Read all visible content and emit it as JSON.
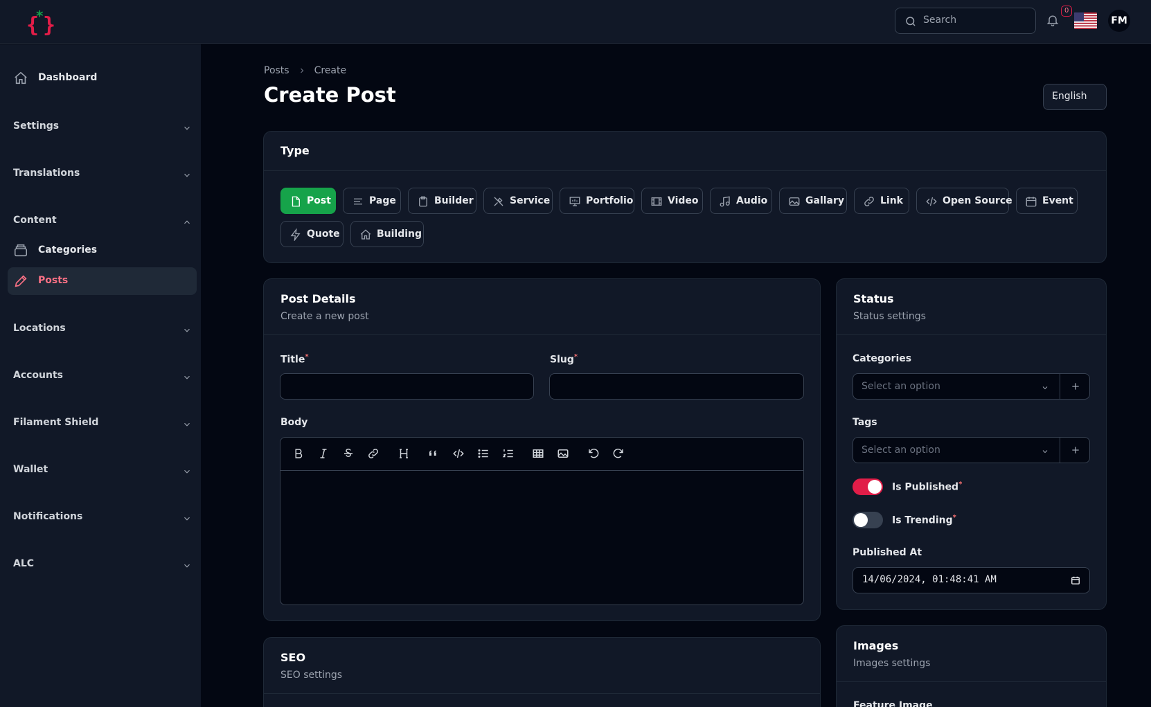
{
  "header": {
    "search_placeholder": "Search",
    "notification_count": "0",
    "user_initials": "FM",
    "logo_icon": "curly-braces-star-logo",
    "flag_icon": "us-flag-icon"
  },
  "sidebar": {
    "dashboard": "Dashboard",
    "groups": {
      "settings": "Settings",
      "translations": "Translations",
      "content": "Content",
      "locations": "Locations",
      "accounts": "Accounts",
      "filament_shield": "Filament Shield",
      "wallet": "Wallet",
      "notifications": "Notifications",
      "alc": "ALC"
    },
    "content_items": {
      "categories": "Categories",
      "posts": "Posts"
    },
    "active_item": "Posts"
  },
  "breadcrumb": {
    "items": [
      "Posts",
      "Create"
    ]
  },
  "page": {
    "title": "Create Post",
    "language": "English"
  },
  "type_section": {
    "title": "Type",
    "selected": "Post",
    "options": [
      "Post",
      "Page",
      "Builder",
      "Service",
      "Portfolio",
      "Video",
      "Audio",
      "Gallary",
      "Link",
      "Open Source",
      "Event",
      "Quote",
      "Building"
    ]
  },
  "post_details": {
    "title": "Post Details",
    "subtitle": "Create a new post",
    "title_label": "Title",
    "slug_label": "Slug",
    "body_label": "Body",
    "required_mark": "*"
  },
  "status": {
    "title": "Status",
    "subtitle": "Status settings",
    "categories_label": "Categories",
    "categories_placeholder": "Select an option",
    "tags_label": "Tags",
    "tags_placeholder": "Select an option",
    "is_published_label": "Is Published",
    "is_published": true,
    "is_trending_label": "Is Trending",
    "is_trending": false,
    "published_at_label": "Published At",
    "published_at": "14/06/2024, 01:48:41 AM"
  },
  "seo": {
    "title": "SEO",
    "subtitle": "SEO settings"
  },
  "images": {
    "title": "Images",
    "subtitle": "Images settings",
    "feature_image_label": "Feature Image"
  },
  "colors": {
    "accent": "#16a34a",
    "active_nav": "#fb7185",
    "toggle_on": "#e11d48"
  }
}
